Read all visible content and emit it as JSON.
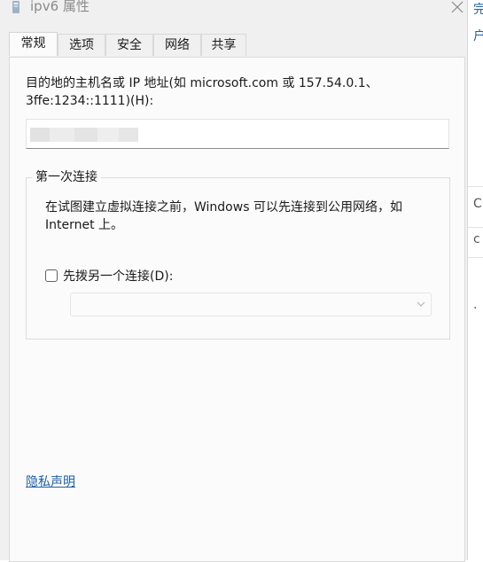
{
  "window": {
    "title": "ipv6 属性"
  },
  "tabs": [
    {
      "label": "常规",
      "active": true
    },
    {
      "label": "选项"
    },
    {
      "label": "安全"
    },
    {
      "label": "网络"
    },
    {
      "label": "共享"
    }
  ],
  "general": {
    "host_label_line1": "目的地的主机名或 IP 地址(如 microsoft.com 或 157.54.0.1、",
    "host_label_line2": "3ffe:1234::1111)(H):",
    "host_value": "",
    "first_connect": {
      "legend": "第一次连接",
      "desc_line1": "在试图建立虚拟连接之前，Windows 可以先连接到公用网络，如",
      "desc_line2": "Internet 上。",
      "dial_checkbox_label": "先拨另一个连接(D):",
      "dial_checked": false,
      "dial_select_value": ""
    },
    "privacy_link": "隐私声明"
  },
  "background_window": {
    "fragments": [
      "完",
      "户",
      "C",
      "c",
      "."
    ]
  },
  "colors": {
    "link": "#1f5fa8",
    "panel_bg": "#fbfbfb",
    "chrome_bg": "#f0f0f0"
  },
  "icons": {
    "title": "network-connection-icon",
    "close": "close-icon",
    "select": "chevron-down-icon"
  }
}
